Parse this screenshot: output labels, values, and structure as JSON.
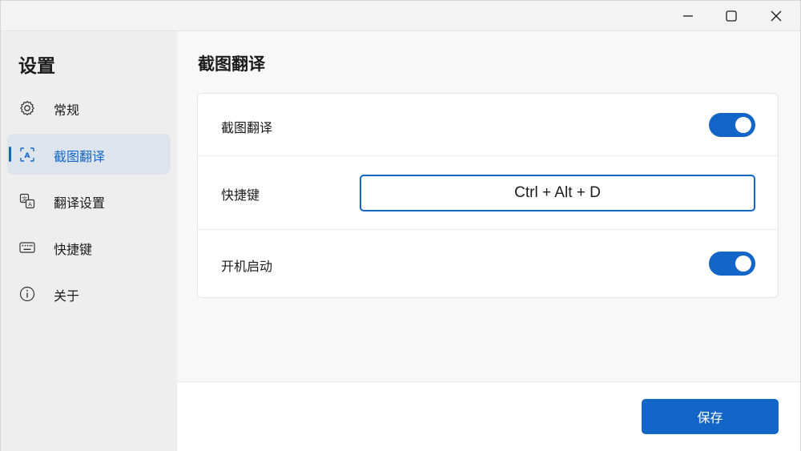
{
  "window": {
    "minimize_icon": "minimize-icon",
    "maximize_icon": "maximize-icon",
    "close_icon": "close-icon"
  },
  "sidebar": {
    "title": "设置",
    "items": [
      {
        "label": "常规",
        "icon": "gear-icon",
        "active": false
      },
      {
        "label": "截图翻译",
        "icon": "screenshot-translate-icon",
        "active": true
      },
      {
        "label": "翻译设置",
        "icon": "translate-icon",
        "active": false
      },
      {
        "label": "快捷键",
        "icon": "keyboard-icon",
        "active": false
      },
      {
        "label": "关于",
        "icon": "info-icon",
        "active": false
      }
    ]
  },
  "main": {
    "title": "截图翻译",
    "rows": [
      {
        "label": "截图翻译",
        "type": "toggle",
        "value": true
      },
      {
        "label": "快捷键",
        "type": "input",
        "value": "Ctrl + Alt + D"
      },
      {
        "label": "开机启动",
        "type": "toggle",
        "value": true
      }
    ]
  },
  "footer": {
    "save_label": "保存"
  },
  "colors": {
    "accent": "#1366c7",
    "sidebar_bg": "#eeeeee",
    "active_item_bg": "#dde4ec"
  }
}
